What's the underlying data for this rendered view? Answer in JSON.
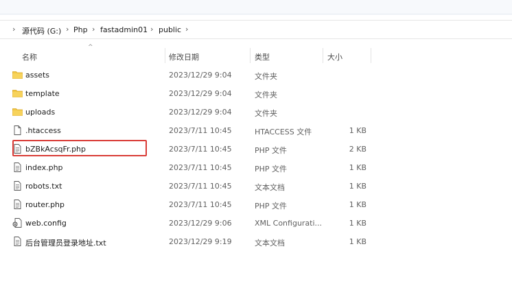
{
  "breadcrumb": {
    "items": [
      "源代码 (G:)",
      "Php",
      "fastadmin01",
      "public"
    ]
  },
  "columns": {
    "name": "名称",
    "date": "修改日期",
    "type": "类型",
    "size": "大小"
  },
  "files": [
    {
      "name": "assets",
      "date": "2023/12/29 9:04",
      "type": "文件夹",
      "size": "",
      "icon": "folder-icon"
    },
    {
      "name": "template",
      "date": "2023/12/29 9:04",
      "type": "文件夹",
      "size": "",
      "icon": "folder-icon"
    },
    {
      "name": "uploads",
      "date": "2023/12/29 9:04",
      "type": "文件夹",
      "size": "",
      "icon": "folder-icon"
    },
    {
      "name": ".htaccess",
      "date": "2023/7/11 10:45",
      "type": "HTACCESS 文件",
      "size": "1 KB",
      "icon": "blank-file-icon"
    },
    {
      "name": "bZBkAcsqFr.php",
      "date": "2023/7/11 10:45",
      "type": "PHP 文件",
      "size": "2 KB",
      "icon": "text-file-icon"
    },
    {
      "name": "index.php",
      "date": "2023/7/11 10:45",
      "type": "PHP 文件",
      "size": "1 KB",
      "icon": "text-file-icon"
    },
    {
      "name": "robots.txt",
      "date": "2023/7/11 10:45",
      "type": "文本文档",
      "size": "1 KB",
      "icon": "text-file-icon"
    },
    {
      "name": "router.php",
      "date": "2023/7/11 10:45",
      "type": "PHP 文件",
      "size": "1 KB",
      "icon": "text-file-icon"
    },
    {
      "name": "web.config",
      "date": "2023/12/29 9:06",
      "type": "XML Configurati...",
      "size": "1 KB",
      "icon": "config-file-icon"
    },
    {
      "name": "后台管理员登录地址.txt",
      "date": "2023/12/29 9:19",
      "type": "文本文档",
      "size": "1 KB",
      "icon": "text-file-icon"
    }
  ],
  "colors": {
    "folder": "#f2c744",
    "highlight": "#d93a35"
  }
}
